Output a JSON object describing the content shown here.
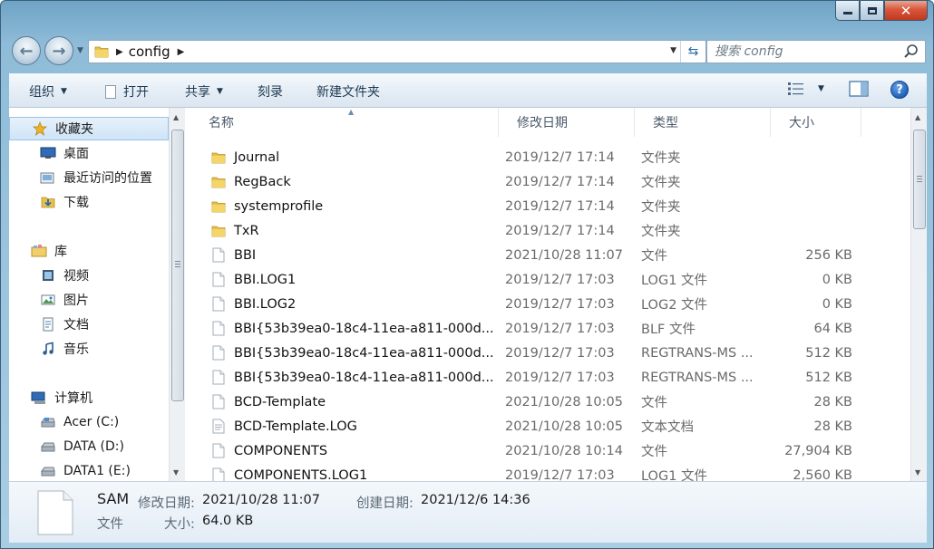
{
  "window": {
    "controls": {
      "minimize": "",
      "maximize": "",
      "close": "✕"
    }
  },
  "address": {
    "crumbs": [
      "config"
    ]
  },
  "search": {
    "placeholder": "搜索 config"
  },
  "toolbar": {
    "organize": "组织",
    "open": "打开",
    "share": "共享",
    "burn": "刻录",
    "new_folder": "新建文件夹"
  },
  "sidebar": {
    "groups": [
      {
        "label": "收藏夹",
        "icon": "star-icon",
        "selected": true,
        "items": [
          {
            "label": "桌面",
            "icon": "desktop-icon"
          },
          {
            "label": "最近访问的位置",
            "icon": "recent-places-icon"
          },
          {
            "label": "下载",
            "icon": "downloads-icon"
          }
        ]
      },
      {
        "label": "库",
        "icon": "library-icon",
        "items": [
          {
            "label": "视频",
            "icon": "video-icon"
          },
          {
            "label": "图片",
            "icon": "pictures-icon"
          },
          {
            "label": "文档",
            "icon": "documents-icon"
          },
          {
            "label": "音乐",
            "icon": "music-icon"
          }
        ]
      },
      {
        "label": "计算机",
        "icon": "computer-icon",
        "items": [
          {
            "label": "Acer (C:)",
            "icon": "system-drive-icon"
          },
          {
            "label": "DATA (D:)",
            "icon": "drive-icon"
          },
          {
            "label": "DATA1 (E:)",
            "icon": "drive-icon"
          }
        ]
      }
    ]
  },
  "columns": {
    "name": "名称",
    "date": "修改日期",
    "type": "类型",
    "size": "大小"
  },
  "files": [
    {
      "name": "Journal",
      "date": "2019/12/7 17:14",
      "type": "文件夹",
      "size": "",
      "kind": "folder"
    },
    {
      "name": "RegBack",
      "date": "2019/12/7 17:14",
      "type": "文件夹",
      "size": "",
      "kind": "folder"
    },
    {
      "name": "systemprofile",
      "date": "2019/12/7 17:14",
      "type": "文件夹",
      "size": "",
      "kind": "folder"
    },
    {
      "name": "TxR",
      "date": "2019/12/7 17:14",
      "type": "文件夹",
      "size": "",
      "kind": "folder"
    },
    {
      "name": "BBI",
      "date": "2021/10/28 11:07",
      "type": "文件",
      "size": "256 KB",
      "kind": "file"
    },
    {
      "name": "BBI.LOG1",
      "date": "2019/12/7 17:03",
      "type": "LOG1 文件",
      "size": "0 KB",
      "kind": "file"
    },
    {
      "name": "BBI.LOG2",
      "date": "2019/12/7 17:03",
      "type": "LOG2 文件",
      "size": "0 KB",
      "kind": "file"
    },
    {
      "name": "BBI{53b39ea0-18c4-11ea-a811-000d...",
      "date": "2019/12/7 17:03",
      "type": "BLF 文件",
      "size": "64 KB",
      "kind": "file"
    },
    {
      "name": "BBI{53b39ea0-18c4-11ea-a811-000d...",
      "date": "2019/12/7 17:03",
      "type": "REGTRANS-MS ...",
      "size": "512 KB",
      "kind": "file"
    },
    {
      "name": "BBI{53b39ea0-18c4-11ea-a811-000d...",
      "date": "2019/12/7 17:03",
      "type": "REGTRANS-MS ...",
      "size": "512 KB",
      "kind": "file"
    },
    {
      "name": "BCD-Template",
      "date": "2021/10/28 10:05",
      "type": "文件",
      "size": "28 KB",
      "kind": "file"
    },
    {
      "name": "BCD-Template.LOG",
      "date": "2021/10/28 10:05",
      "type": "文本文档",
      "size": "28 KB",
      "kind": "text"
    },
    {
      "name": "COMPONENTS",
      "date": "2021/10/28 10:14",
      "type": "文件",
      "size": "27,904 KB",
      "kind": "file"
    },
    {
      "name": "COMPONENTS.LOG1",
      "date": "2019/12/7 17:03",
      "type": "LOG1 文件",
      "size": "2,560 KB",
      "kind": "file"
    }
  ],
  "details": {
    "name": "SAM",
    "type": "文件",
    "modified_label": "修改日期:",
    "modified": "2021/10/28 11:07",
    "created_label": "创建日期:",
    "created": "2021/12/6 14:36",
    "size_label": "大小:",
    "size": "64.0 KB"
  }
}
